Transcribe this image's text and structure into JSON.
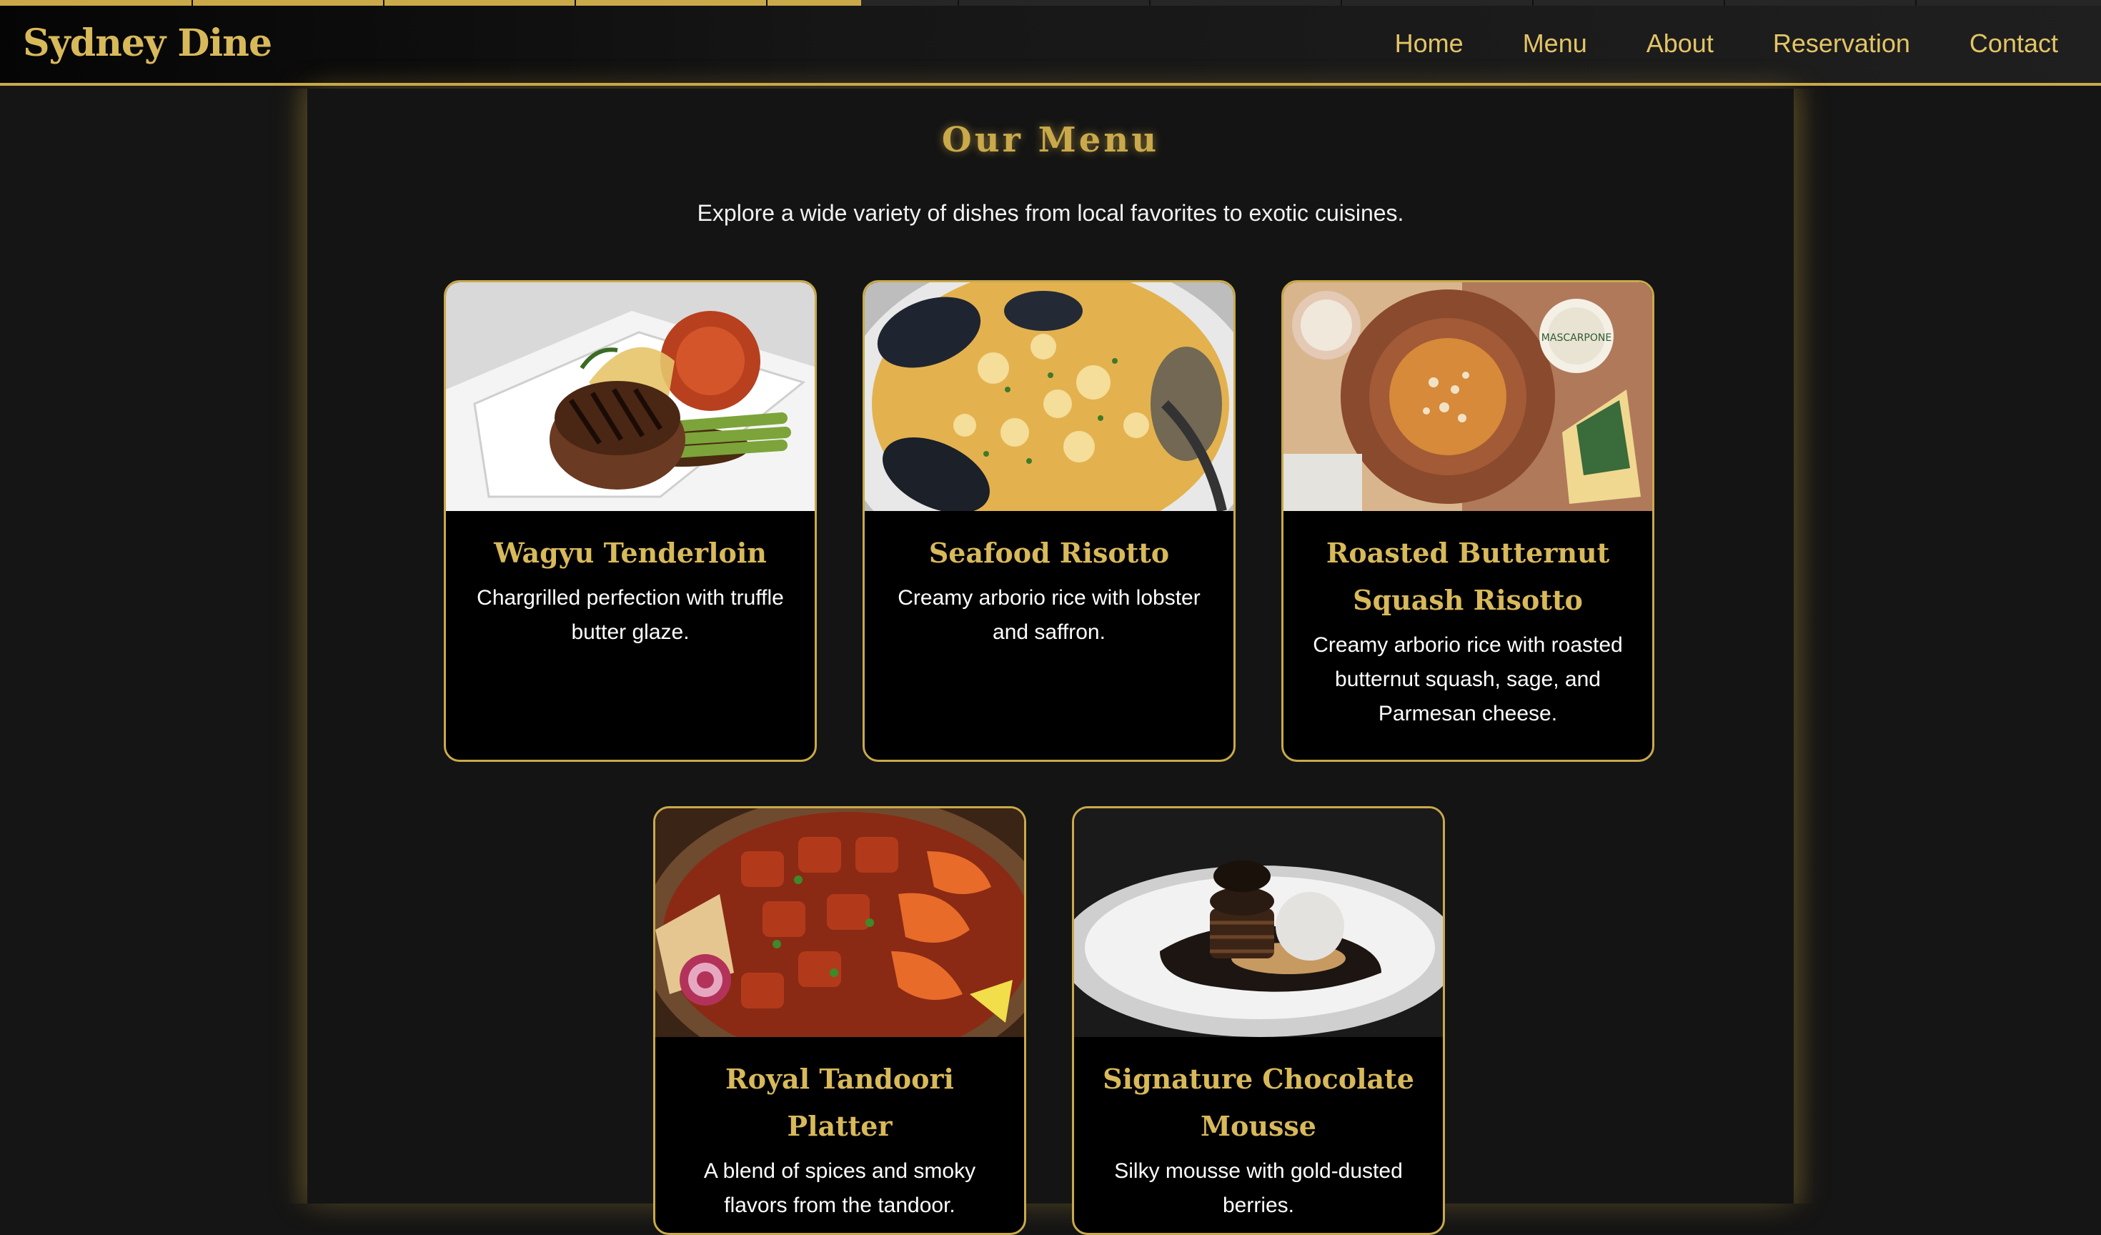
{
  "app": {
    "brand": "Sydney Dine",
    "accent_color": "#c9a94a",
    "page_progress": 0.41
  },
  "nav": {
    "items": [
      {
        "label": "Home"
      },
      {
        "label": "Menu"
      },
      {
        "label": "About"
      },
      {
        "label": "Reservation"
      },
      {
        "label": "Contact"
      }
    ]
  },
  "main": {
    "title": "Our Menu",
    "subtitle": "Explore a wide variety of dishes from local favorites to exotic cuisines."
  },
  "menu": {
    "items": [
      {
        "name": "Wagyu Tenderloin",
        "description": "Chargrilled perfection with truffle butter glaze.",
        "image": "steak-photo"
      },
      {
        "name": "Seafood Risotto",
        "description": "Creamy arborio rice with lobster and saffron.",
        "image": "seafood-risotto-photo"
      },
      {
        "name": "Roasted Butternut Squash Risotto",
        "description": "Creamy arborio rice with roasted butternut squash, sage, and Parmesan cheese.",
        "image": "squash-risotto-photo"
      },
      {
        "name": "Royal Tandoori Platter",
        "description": "A blend of spices and smoky flavors from the tandoor.",
        "image": "tandoori-photo"
      },
      {
        "name": "Signature Chocolate Mousse",
        "description": "Silky mousse with gold-dusted berries.",
        "image": "chocolate-mousse-photo"
      }
    ]
  }
}
